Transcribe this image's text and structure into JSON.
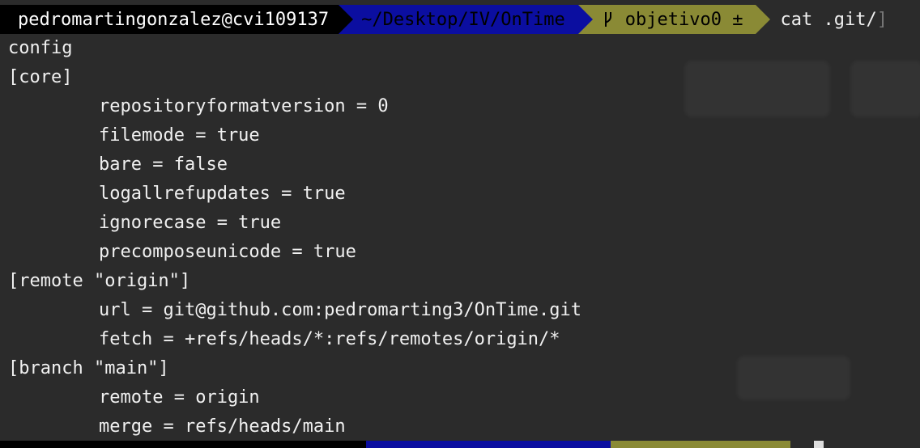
{
  "prompt": {
    "user_host": "pedromartingonzalez@cvi109137",
    "path": "~/Desktop/IV/OnTime",
    "branch": "objetivo0 ±",
    "command": "cat .git/",
    "left_bracket": "[",
    "right_bracket": "]"
  },
  "output": {
    "lines": [
      "config",
      "[core]",
      "repositoryformatversion = 0",
      "filemode = true",
      "bare = false",
      "logallrefupdates = true",
      "ignorecase = true",
      "precomposeunicode = true",
      "[remote \"origin\"]",
      "url = git@github.com:pedromarting3/OnTime.git",
      "fetch = +refs/heads/*:refs/remotes/origin/*",
      "[branch \"main\"]",
      "remote = origin",
      "merge = refs/heads/main"
    ]
  },
  "colors": {
    "background": "#2b2b2b",
    "user_segment": "#000000",
    "path_segment": "#0b0ea0",
    "git_segment": "#8a8a35",
    "text": "#f0f0f0"
  },
  "icons": [
    "git-branch-icon"
  ]
}
